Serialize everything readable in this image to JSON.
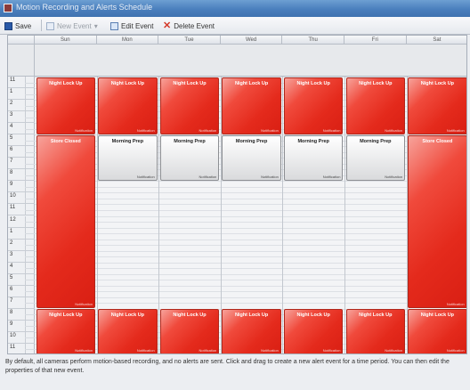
{
  "window": {
    "title": "Motion Recording and Alerts Schedule"
  },
  "toolbar": {
    "save": "Save",
    "new_event": "New Event",
    "edit_event": "Edit Event",
    "delete_event": "Delete Event"
  },
  "days": [
    {
      "label": "Sun"
    },
    {
      "label": "Mon"
    },
    {
      "label": "Tue"
    },
    {
      "label": "Wed"
    },
    {
      "label": "Thu"
    },
    {
      "label": "Fri"
    },
    {
      "label": "Sat"
    }
  ],
  "hours": [
    "11",
    "1",
    "2",
    "3",
    "4",
    "5",
    "6",
    "7",
    "8",
    "9",
    "10",
    "11",
    "12",
    "1",
    "2",
    "3",
    "4",
    "5",
    "6",
    "7",
    "8",
    "9",
    "10",
    "11"
  ],
  "events": {
    "night_lock_up": "Night Lock Up",
    "store_closed": "Store Closed",
    "morning_prep": "Morning Prep",
    "event_footer": "Notification"
  },
  "status_text": "By default, all cameras perform motion-based recording, and no alerts are sent. Click and drag to create a new alert event for a time period. You can then edit the properties of that new event.",
  "colors": {
    "event_red": "#e42a1c",
    "event_gray": "#e6e6e6",
    "titlebar": "#4a7fbd"
  }
}
